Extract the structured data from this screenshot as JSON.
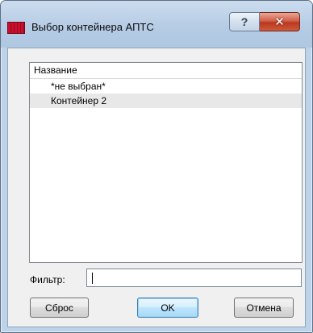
{
  "window": {
    "title": "Выбор контейнера АПТС",
    "help_label": "?",
    "close_label": "✕"
  },
  "list": {
    "column_header": "Название",
    "rows": [
      {
        "label": "*не выбран*",
        "selected": false
      },
      {
        "label": "Контейнер 2",
        "selected": true
      }
    ]
  },
  "filter": {
    "label": "Фильтр:",
    "value": ""
  },
  "buttons": {
    "reset": "Сброс",
    "ok": "OK",
    "cancel": "Отмена"
  },
  "colors": {
    "title_bar": "#b9cfe7",
    "close_button": "#c8452b",
    "selection": "#e8e8e8"
  }
}
